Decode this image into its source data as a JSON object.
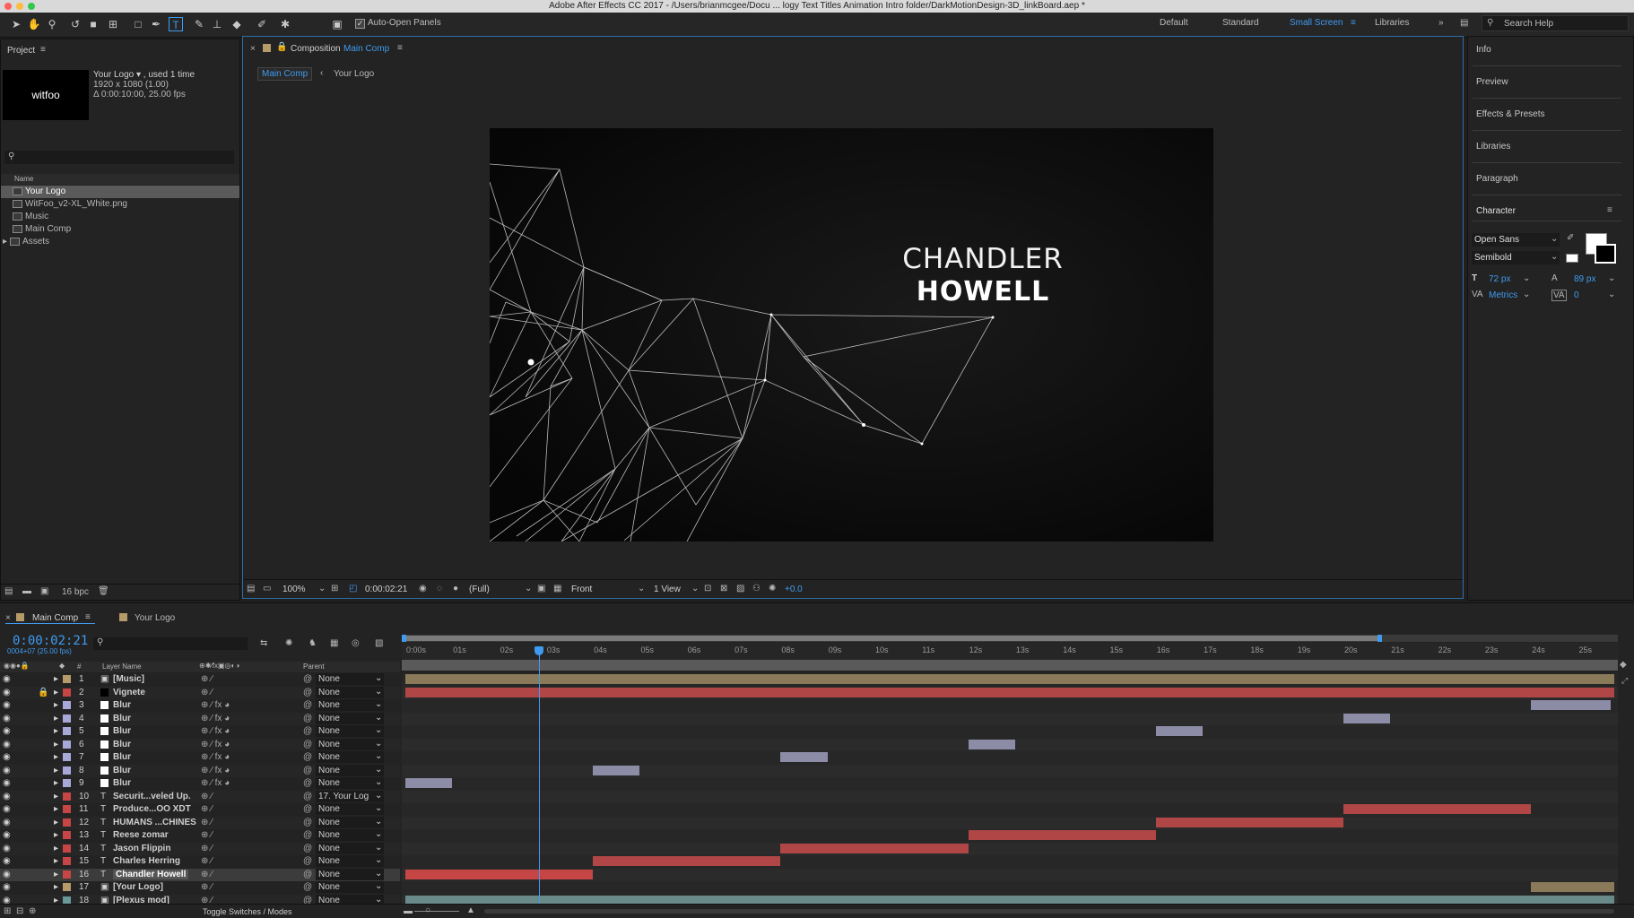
{
  "window": {
    "title": "Adobe After Effects CC 2017 - /Users/brianmcgee/Docu ... logy Text Titles Animation Intro folder/DarkMotionDesign-3D_linkBoard.aep *"
  },
  "toolbar": {
    "auto_open_label": "Auto-Open Panels",
    "workspaces": [
      "Default",
      "Standard",
      "Small Screen",
      "Libraries"
    ],
    "search_placeholder": "Search Help"
  },
  "project": {
    "title": "Project",
    "thumb_text": "witfoo",
    "info_name": "Your Logo ▾ , used 1 time",
    "info_dims": "1920 x 1080 (1.00)",
    "info_duration": "Δ 0:00:10:00, 25.00 fps",
    "col_name": "Name",
    "items": [
      "Your Logo",
      "WitFoo_v2-XL_White.png",
      "Music",
      "Main Comp",
      "Assets"
    ],
    "bpc": "16 bpc"
  },
  "comp": {
    "panel_title": "Composition",
    "panel_name": "Main Comp",
    "breadcrumb": [
      "Main Comp",
      "Your Logo"
    ],
    "text_line1": "CHANDLER",
    "text_line2": "HOWELL",
    "zoom": "100%",
    "timecode": "0:00:02:21",
    "resolution": "(Full)",
    "view": "Front",
    "views_count": "1 View",
    "exposure": "+0.0"
  },
  "right_panel": {
    "items": [
      "Info",
      "Preview",
      "Effects & Presets",
      "Libraries",
      "Paragraph",
      "Character"
    ],
    "font": "Open Sans",
    "style": "Semibold",
    "size": "72 px",
    "leading": "89 px",
    "kerning": "Metrics",
    "tracking": "0"
  },
  "timeline": {
    "tabs": [
      "Main Comp",
      "Your Logo"
    ],
    "timecode": "0:00:02:21",
    "frames": "0004+07 (25.00 fps)",
    "col_layer_name": "Layer Name",
    "col_parent": "Parent",
    "ruler": [
      "0:00s",
      "01s",
      "02s",
      "03s",
      "04s",
      "05s",
      "06s",
      "07s",
      "08s",
      "09s",
      "10s",
      "11s",
      "12s",
      "13s",
      "14s",
      "15s",
      "16s",
      "17s",
      "18s",
      "19s",
      "20s",
      "21s",
      "22s",
      "23s",
      "24s",
      "25s"
    ],
    "layers": [
      {
        "num": "1",
        "name": "[Music]",
        "type": "comp",
        "color": "#b59a6a",
        "parent": "None"
      },
      {
        "num": "2",
        "name": "Vignete",
        "type": "solid-black",
        "color": "#c64646",
        "parent": "None"
      },
      {
        "num": "3",
        "name": "Blur",
        "type": "solid-white",
        "color": "#a8a8d8",
        "parent": "None"
      },
      {
        "num": "4",
        "name": "Blur",
        "type": "solid-white",
        "color": "#a8a8d8",
        "parent": "None"
      },
      {
        "num": "5",
        "name": "Blur",
        "type": "solid-white",
        "color": "#a8a8d8",
        "parent": "None"
      },
      {
        "num": "6",
        "name": "Blur",
        "type": "solid-white",
        "color": "#a8a8d8",
        "parent": "None"
      },
      {
        "num": "7",
        "name": "Blur",
        "type": "solid-white",
        "color": "#a8a8d8",
        "parent": "None"
      },
      {
        "num": "8",
        "name": "Blur",
        "type": "solid-white",
        "color": "#a8a8d8",
        "parent": "None"
      },
      {
        "num": "9",
        "name": "Blur",
        "type": "solid-white",
        "color": "#a8a8d8",
        "parent": "None"
      },
      {
        "num": "10",
        "name": "Securit...veled Up.",
        "type": "text",
        "color": "#c64646",
        "parent": "17. Your Log"
      },
      {
        "num": "11",
        "name": "Produce...OO XDT",
        "type": "text",
        "color": "#c64646",
        "parent": "None"
      },
      {
        "num": "12",
        "name": "HUMANS ...CHINES",
        "type": "text",
        "color": "#c64646",
        "parent": "None"
      },
      {
        "num": "13",
        "name": "Reese zomar",
        "type": "text",
        "color": "#c64646",
        "parent": "None"
      },
      {
        "num": "14",
        "name": "Jason Flippin",
        "type": "text",
        "color": "#c64646",
        "parent": "None"
      },
      {
        "num": "15",
        "name": "Charles Herring",
        "type": "text",
        "color": "#c64646",
        "parent": "None"
      },
      {
        "num": "16",
        "name": "Chandler Howell",
        "type": "text",
        "color": "#c64646",
        "parent": "None"
      },
      {
        "num": "17",
        "name": "[Your Logo]",
        "type": "comp",
        "color": "#b59a6a",
        "parent": "None"
      },
      {
        "num": "18",
        "name": "[Plexus mod]",
        "type": "comp",
        "color": "#6a9a9a",
        "parent": "None"
      }
    ],
    "footer": "Toggle Switches / Modes"
  },
  "colors": {
    "accent": "#3f9bf0",
    "layer_red": "#c64646",
    "layer_tan": "#8a7a5a",
    "layer_lavender": "#8c8ca6"
  }
}
